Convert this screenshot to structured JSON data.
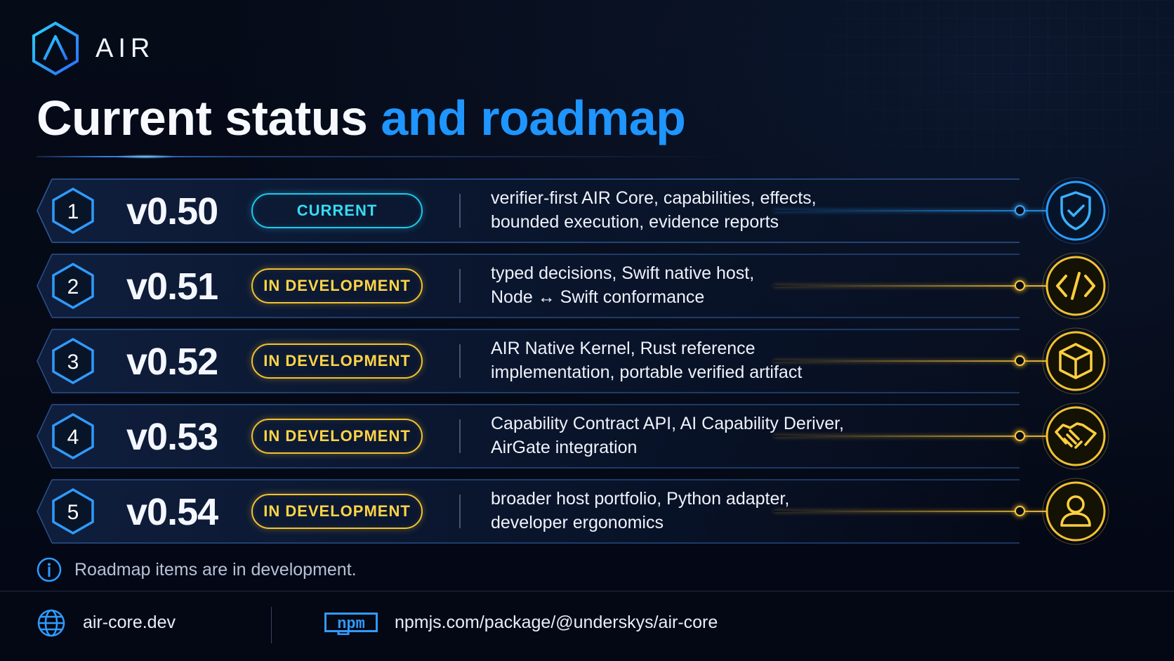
{
  "brand": {
    "name": "AIR",
    "logo_icon": "air-hexagon-logo"
  },
  "title": {
    "part1": "Current status",
    "part2": "and roadmap"
  },
  "colors": {
    "accent_blue": "#1f95ff",
    "current_cyan": "#1fc8e8",
    "dev_gold": "#f2c232",
    "background": "#050a17"
  },
  "roadmap": [
    {
      "number": "1",
      "version": "v0.50",
      "status": "CURRENT",
      "status_kind": "current",
      "desc_line1": "verifier-first AIR Core, capabilities, effects,",
      "desc_line2": "bounded execution, evidence reports",
      "icon": "shield-check-icon"
    },
    {
      "number": "2",
      "version": "v0.51",
      "status": "IN DEVELOPMENT",
      "status_kind": "dev",
      "desc_line1": "typed decisions, Swift native host,",
      "desc_line2": "Node ↔ Swift conformance",
      "icon": "code-icon"
    },
    {
      "number": "3",
      "version": "v0.52",
      "status": "IN DEVELOPMENT",
      "status_kind": "dev",
      "desc_line1": "AIR Native Kernel, Rust reference",
      "desc_line2": "implementation, portable verified artifact",
      "icon": "cube-icon"
    },
    {
      "number": "4",
      "version": "v0.53",
      "status": "IN DEVELOPMENT",
      "status_kind": "dev",
      "desc_line1": "Capability Contract API, AI Capability Deriver,",
      "desc_line2": "AirGate integration",
      "icon": "handshake-icon"
    },
    {
      "number": "5",
      "version": "v0.54",
      "status": "IN DEVELOPMENT",
      "status_kind": "dev",
      "desc_line1": "broader host portfolio, Python adapter,",
      "desc_line2": "developer ergonomics",
      "icon": "user-icon"
    }
  ],
  "note": {
    "text": "Roadmap items are in development.",
    "icon": "info-icon"
  },
  "footer": {
    "site": "air-core.dev",
    "site_icon": "globe-icon",
    "npm_label": "npm",
    "npm_icon": "npm-icon",
    "package": "npmjs.com/package/@underskys/air-core"
  }
}
